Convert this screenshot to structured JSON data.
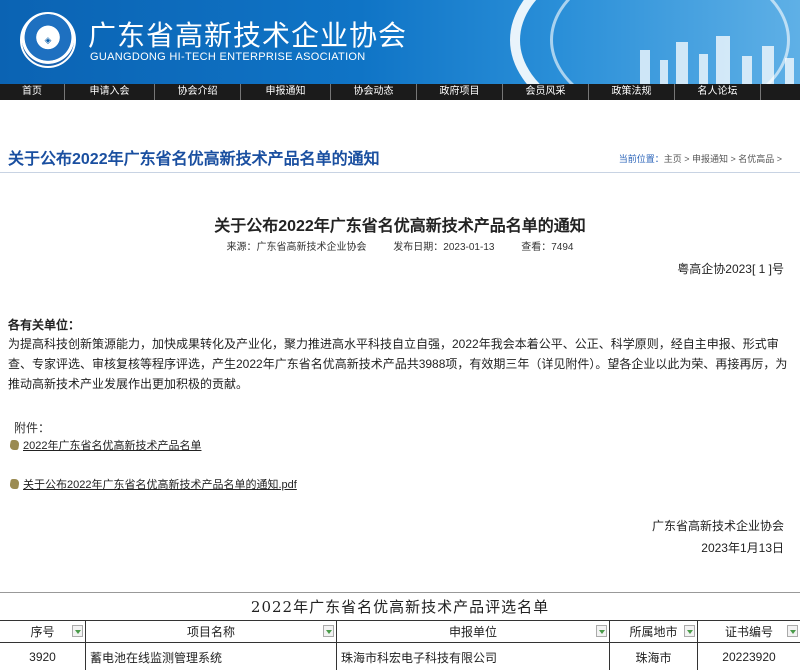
{
  "header": {
    "title": "广东省高新技术企业协会",
    "subtitle": "GUANGDONG HI-TECH ENTERPRISE ASOCIATION"
  },
  "nav": {
    "items": [
      "首页",
      "申请入会",
      "协会介绍",
      "申报通知",
      "协会动态",
      "政府项目",
      "会员风采",
      "政策法规",
      "名人论坛"
    ]
  },
  "page": {
    "title": "关于公布2022年广东省名优高新技术产品名单的通知",
    "breadcrumb_label": "当前位置：",
    "breadcrumb": "主页 > 申报通知 > 名优高品 >"
  },
  "article": {
    "title": "关于公布2022年广东省名优高新技术产品名单的通知",
    "source": "来源：广东省高新技术企业协会",
    "date": "发布日期：2023-01-13",
    "views": "查看：7494",
    "doc_number": "粤高企协2023[ 1 ]号",
    "salutation": "各有关单位：",
    "body": "为提高科技创新策源能力，加快成果转化及产业化，聚力推进高水平科技自立自强，2022年我会本着公平、公正、科学原则，经自主申报、形式审查、专家评选、审核复核等程序评选，产生2022年广东省名优高新技术产品共3988项，有效期三年（详见附件）。望各企业以此为荣、再接再厉，为推动高新技术产业发展作出更加积极的贡献。",
    "attachments_label": "附件：",
    "attachments": [
      "2022年广东省名优高新技术产品名单",
      "关于公布2022年广东省名优高新技术产品名单的通知.pdf"
    ],
    "signature_org": "广东省高新技术企业协会",
    "signature_date": "2023年1月13日"
  },
  "sheet": {
    "title": "2022年广东省名优高新技术产品评选名单",
    "headers": [
      "序号",
      "项目名称",
      "申报单位",
      "所属地市",
      "证书编号"
    ],
    "rows": [
      [
        "3920",
        "蓄电池在线监测管理系统",
        "珠海市科宏电子科技有限公司",
        "珠海市",
        "20223920"
      ]
    ]
  },
  "colors": {
    "brand_blue": "#0f74c6",
    "nav_bg": "#1b1b1b",
    "title_blue": "#1a4fa0"
  }
}
